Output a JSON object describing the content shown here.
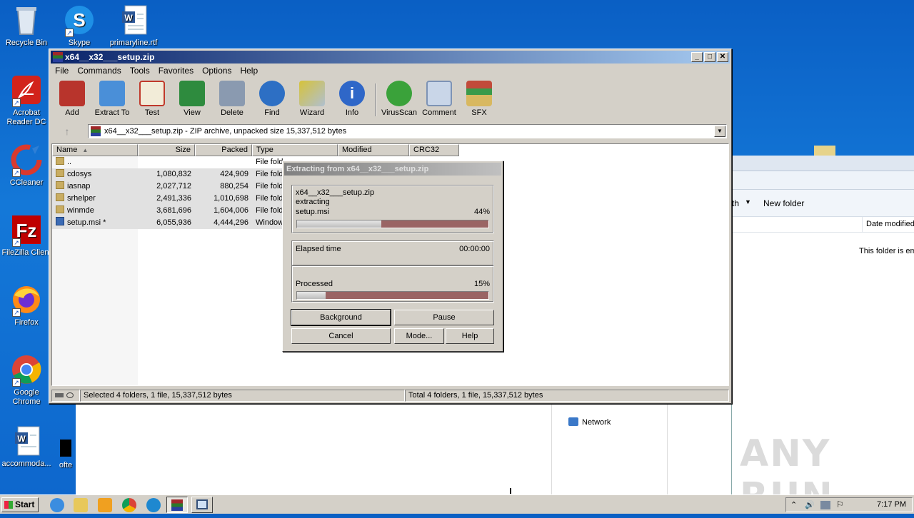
{
  "desktop": {
    "icons": [
      {
        "label": "Recycle Bin",
        "icon": "recycle-bin-icon"
      },
      {
        "label": "Skype",
        "icon": "skype-icon"
      },
      {
        "label": "primaryline.rtf",
        "icon": "word-document-icon"
      },
      {
        "label": "Acrobat Reader DC",
        "icon": "acrobat-icon"
      },
      {
        "label": "CCleaner",
        "icon": "ccleaner-icon"
      },
      {
        "label": "FileZilla Client",
        "icon": "filezilla-icon"
      },
      {
        "label": "Firefox",
        "icon": "firefox-icon"
      },
      {
        "label": "Google Chrome",
        "icon": "chrome-icon"
      },
      {
        "label": "accommoda...",
        "icon": "word-document-icon"
      },
      {
        "label": "ofte",
        "icon": "black-file-icon"
      }
    ]
  },
  "explorer": {
    "new_folder": "New folder",
    "share_with": "th",
    "date_modified": "Date modified",
    "empty_msg": "This folder is em",
    "network": "Network"
  },
  "winrar": {
    "title": "x64__x32___setup.zip",
    "menu": [
      "File",
      "Commands",
      "Tools",
      "Favorites",
      "Options",
      "Help"
    ],
    "toolbar": [
      {
        "label": "Add",
        "icon": "add-archive-icon",
        "color": "#b8342c"
      },
      {
        "label": "Extract To",
        "icon": "extract-folder-icon",
        "color": "#4a8fd8"
      },
      {
        "label": "Test",
        "icon": "test-clipboard-icon",
        "color": "#c0392b"
      },
      {
        "label": "View",
        "icon": "view-book-icon",
        "color": "#2e8b3e"
      },
      {
        "label": "Delete",
        "icon": "trash-icon",
        "color": "#8a9ab0"
      },
      {
        "label": "Find",
        "icon": "magnifier-icon",
        "color": "#2d6fc4"
      },
      {
        "label": "Wizard",
        "icon": "wizard-wand-icon",
        "color": "#d6c23a"
      },
      {
        "label": "Info",
        "icon": "info-icon",
        "color": "#2f67c8"
      },
      {
        "label": "VirusScan",
        "icon": "virus-scan-icon",
        "color": "#3aa23a"
      },
      {
        "label": "Comment",
        "icon": "comment-icon",
        "color": "#7d93b5"
      },
      {
        "label": "SFX",
        "icon": "sfx-box-icon",
        "color": "#c24a3a"
      }
    ],
    "path": "x64__x32___setup.zip - ZIP archive, unpacked size 15,337,512 bytes",
    "columns": [
      "Name",
      "Size",
      "Packed",
      "Type",
      "Modified",
      "CRC32"
    ],
    "rows": [
      {
        "name": "..",
        "size": "",
        "packed": "",
        "type": "File fold",
        "kind": "folder"
      },
      {
        "name": "cdosys",
        "size": "1,080,832",
        "packed": "424,909",
        "type": "File fold",
        "kind": "folder"
      },
      {
        "name": "iasnap",
        "size": "2,027,712",
        "packed": "880,254",
        "type": "File fold",
        "kind": "folder"
      },
      {
        "name": "srhelper",
        "size": "2,491,336",
        "packed": "1,010,698",
        "type": "File fold",
        "kind": "folder"
      },
      {
        "name": "winmde",
        "size": "3,681,696",
        "packed": "1,604,006",
        "type": "File fold",
        "kind": "folder"
      },
      {
        "name": "setup.msi *",
        "size": "6,055,936",
        "packed": "4,444,296",
        "type": "Window",
        "kind": "msi"
      }
    ],
    "status_left": "Selected 4 folders, 1 file, 15,337,512 bytes",
    "status_right": "Total 4 folders, 1 file, 15,337,512 bytes"
  },
  "dialog": {
    "title": "Extracting from x64__x32___setup.zip",
    "archive": "x64__x32___setup.zip",
    "action": "extracting",
    "file": "setup.msi",
    "file_percent": "44%",
    "file_progress": 0.44,
    "elapsed_label": "Elapsed time",
    "elapsed_value": "00:00:00",
    "processed_label": "Processed",
    "processed_percent": "15%",
    "processed_progress": 0.15,
    "buttons": {
      "background": "Background",
      "pause": "Pause",
      "cancel": "Cancel",
      "mode": "Mode...",
      "help": "Help"
    }
  },
  "taskbar": {
    "start": "Start",
    "apps": [
      "ie-icon",
      "explorer-icon",
      "media-player-icon",
      "chrome-icon",
      "edge-icon",
      "winrar-icon",
      "remote-icon"
    ],
    "clock": "7:17 PM"
  },
  "watermark": "ANY RUN"
}
